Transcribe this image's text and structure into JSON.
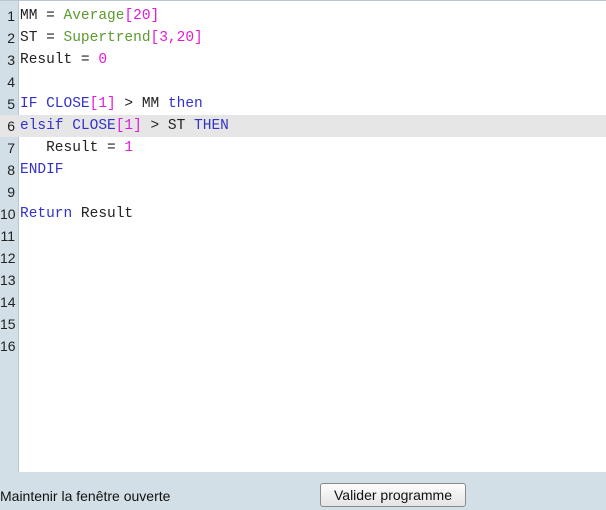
{
  "editor": {
    "current_line": 6,
    "lines": [
      {
        "n": "1",
        "tokens": [
          {
            "t": "MM = ",
            "k": "id"
          },
          {
            "t": "Average",
            "k": "fn"
          },
          {
            "t": "[20]",
            "k": "num"
          }
        ]
      },
      {
        "n": "2",
        "tokens": [
          {
            "t": "ST = ",
            "k": "id"
          },
          {
            "t": "Supertrend",
            "k": "fn"
          },
          {
            "t": "[3,20]",
            "k": "num"
          }
        ]
      },
      {
        "n": "3",
        "tokens": [
          {
            "t": "Result = ",
            "k": "id"
          },
          {
            "t": "0",
            "k": "num"
          }
        ]
      },
      {
        "n": "4",
        "tokens": []
      },
      {
        "n": "5",
        "tokens": [
          {
            "t": "IF CLOSE",
            "k": "kw"
          },
          {
            "t": "[1]",
            "k": "num"
          },
          {
            "t": " > MM ",
            "k": "op"
          },
          {
            "t": "then",
            "k": "kw"
          }
        ]
      },
      {
        "n": "6",
        "tokens": [
          {
            "t": "elsif CLOSE",
            "k": "kw"
          },
          {
            "t": "[1]",
            "k": "num"
          },
          {
            "t": " > ST ",
            "k": "op"
          },
          {
            "t": "THEN",
            "k": "kw"
          }
        ]
      },
      {
        "n": "7",
        "tokens": [
          {
            "t": "   Result = ",
            "k": "id"
          },
          {
            "t": "1",
            "k": "num"
          }
        ]
      },
      {
        "n": "8",
        "tokens": [
          {
            "t": "ENDIF",
            "k": "kw"
          }
        ]
      },
      {
        "n": "9",
        "tokens": []
      },
      {
        "n": "10",
        "tokens": [
          {
            "t": "Return",
            "k": "kw"
          },
          {
            "t": " Result",
            "k": "id"
          }
        ]
      },
      {
        "n": "11",
        "tokens": []
      },
      {
        "n": "12",
        "tokens": []
      },
      {
        "n": "13",
        "tokens": []
      },
      {
        "n": "14",
        "tokens": []
      },
      {
        "n": "15",
        "tokens": []
      },
      {
        "n": "16",
        "tokens": []
      }
    ]
  },
  "footer": {
    "keep_open_label": "Maintenir la fenêtre ouverte",
    "validate_label": "Valider programme"
  }
}
